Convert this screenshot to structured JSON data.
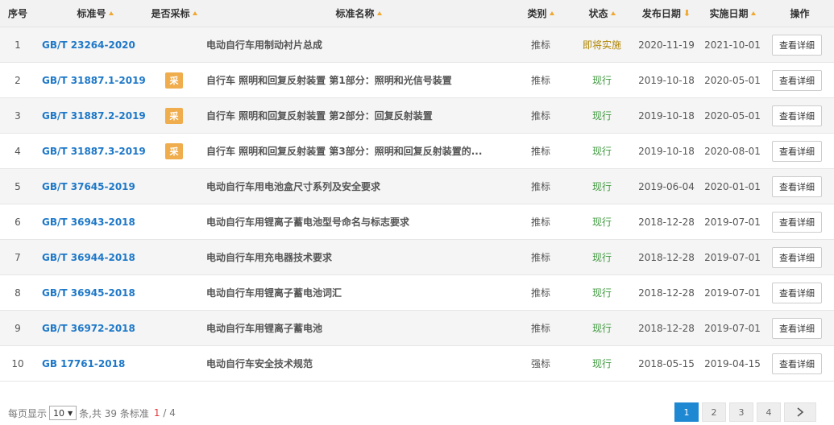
{
  "colors": {
    "link": "#1e78c8",
    "status_upcoming": "#b08400",
    "status_current": "#3f9a3f",
    "badge": "#f0ad4e",
    "sort_arrow": "#f0a830",
    "pager_active": "#1e88d2"
  },
  "headers": {
    "idx": "序号",
    "code": "标准号",
    "cai": "是否采标",
    "name": "标准名称",
    "type": "类别",
    "status": "状态",
    "pub": "发布日期",
    "imp": "实施日期",
    "op": "操作"
  },
  "rows": [
    {
      "idx": "1",
      "code": "GB/T 23264-2020",
      "cai": "",
      "name": "电动自行车用制动衬片总成",
      "type": "推标",
      "status": "即将实施",
      "status_kind": "upcoming",
      "pub": "2020-11-19",
      "imp": "2021-10-01",
      "op": "查看详细"
    },
    {
      "idx": "2",
      "code": "GB/T 31887.1-2019",
      "cai": "采",
      "name": "自行车 照明和回复反射装置 第1部分：照明和光信号装置",
      "type": "推标",
      "status": "现行",
      "status_kind": "current",
      "pub": "2019-10-18",
      "imp": "2020-05-01",
      "op": "查看详细"
    },
    {
      "idx": "3",
      "code": "GB/T 31887.2-2019",
      "cai": "采",
      "name": "自行车 照明和回复反射装置 第2部分：回复反射装置",
      "type": "推标",
      "status": "现行",
      "status_kind": "current",
      "pub": "2019-10-18",
      "imp": "2020-05-01",
      "op": "查看详细"
    },
    {
      "idx": "4",
      "code": "GB/T 31887.3-2019",
      "cai": "采",
      "name": "自行车 照明和回复反射装置 第3部分：照明和回复反射装置的...",
      "type": "推标",
      "status": "现行",
      "status_kind": "current",
      "pub": "2019-10-18",
      "imp": "2020-08-01",
      "op": "查看详细"
    },
    {
      "idx": "5",
      "code": "GB/T 37645-2019",
      "cai": "",
      "name": "电动自行车用电池盒尺寸系列及安全要求",
      "type": "推标",
      "status": "现行",
      "status_kind": "current",
      "pub": "2019-06-04",
      "imp": "2020-01-01",
      "op": "查看详细"
    },
    {
      "idx": "6",
      "code": "GB/T 36943-2018",
      "cai": "",
      "name": "电动自行车用锂离子蓄电池型号命名与标志要求",
      "type": "推标",
      "status": "现行",
      "status_kind": "current",
      "pub": "2018-12-28",
      "imp": "2019-07-01",
      "op": "查看详细"
    },
    {
      "idx": "7",
      "code": "GB/T 36944-2018",
      "cai": "",
      "name": "电动自行车用充电器技术要求",
      "type": "推标",
      "status": "现行",
      "status_kind": "current",
      "pub": "2018-12-28",
      "imp": "2019-07-01",
      "op": "查看详细"
    },
    {
      "idx": "8",
      "code": "GB/T 36945-2018",
      "cai": "",
      "name": "电动自行车用锂离子蓄电池词汇",
      "type": "推标",
      "status": "现行",
      "status_kind": "current",
      "pub": "2018-12-28",
      "imp": "2019-07-01",
      "op": "查看详细"
    },
    {
      "idx": "9",
      "code": "GB/T 36972-2018",
      "cai": "",
      "name": "电动自行车用锂离子蓄电池",
      "type": "推标",
      "status": "现行",
      "status_kind": "current",
      "pub": "2018-12-28",
      "imp": "2019-07-01",
      "op": "查看详细"
    },
    {
      "idx": "10",
      "code": "GB 17761-2018",
      "cai": "",
      "name": "电动自行车安全技术规范",
      "type": "强标",
      "status": "现行",
      "status_kind": "current",
      "pub": "2018-05-15",
      "imp": "2019-04-15",
      "op": "查看详细"
    }
  ],
  "footer": {
    "per_page_prefix": "每页显示",
    "per_page_value": "10",
    "per_page_suffix": "条,共 39 条标准",
    "page_current": "1",
    "page_sep": " / ",
    "page_total": "4",
    "pages": [
      "1",
      "2",
      "3",
      "4"
    ],
    "active_page": "1",
    "next_icon": "chevron-right-icon"
  }
}
